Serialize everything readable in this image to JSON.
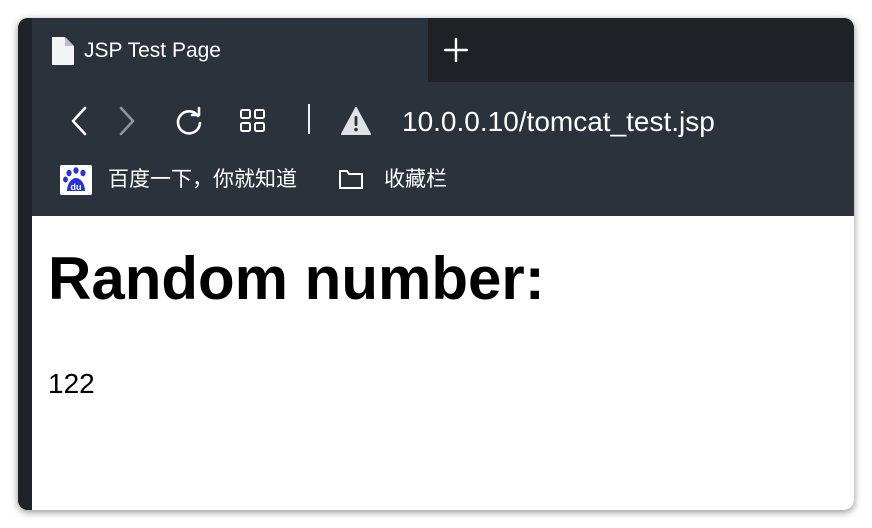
{
  "browser": {
    "tab": {
      "title": "JSP Test Page",
      "icon": "document-icon"
    },
    "new_tab_icon": "plus-icon",
    "toolbar": {
      "back_icon": "chevron-left-icon",
      "forward_icon": "chevron-right-icon",
      "reload_icon": "reload-icon",
      "tabs_grid_icon": "grid-icon",
      "security_icon": "warning-icon",
      "url": "10.0.0.10/tomcat_test.jsp"
    },
    "bookmarks": [
      {
        "label": "百度一下，你就知道",
        "icon": "baidu-icon"
      },
      {
        "label": "收藏栏",
        "icon": "folder-icon"
      }
    ]
  },
  "page": {
    "heading": "Random number:",
    "value": "122"
  },
  "colors": {
    "chrome_bg": "#2a333c",
    "tabstrip_bg": "#1e2227",
    "content_bg": "#ffffff",
    "baidu_blue": "#2932e1"
  }
}
